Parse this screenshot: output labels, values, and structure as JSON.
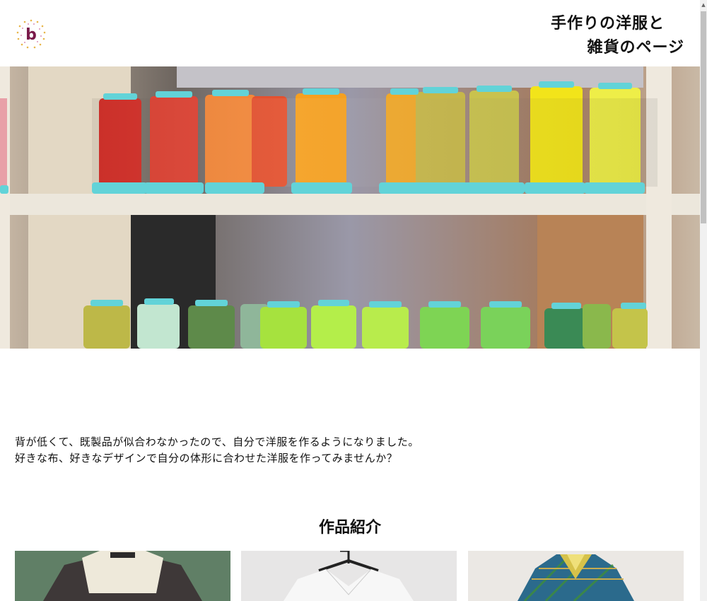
{
  "header": {
    "logo_letter": "b",
    "title_line1": "手作りの洋服と",
    "title_line2": "雑貨のページ"
  },
  "intro": {
    "line1": "背が低くて、既製品が似合わなかったので、自分で洋服を作るようになりました。",
    "line2": "好きな布、好きなデザインで自分の体形に合わせた洋服を作ってみませんか？"
  },
  "works": {
    "heading": "作品紹介"
  },
  "colors": {
    "logo_accent": "#7a1a4a",
    "thread_cap": "#62d3d8"
  }
}
